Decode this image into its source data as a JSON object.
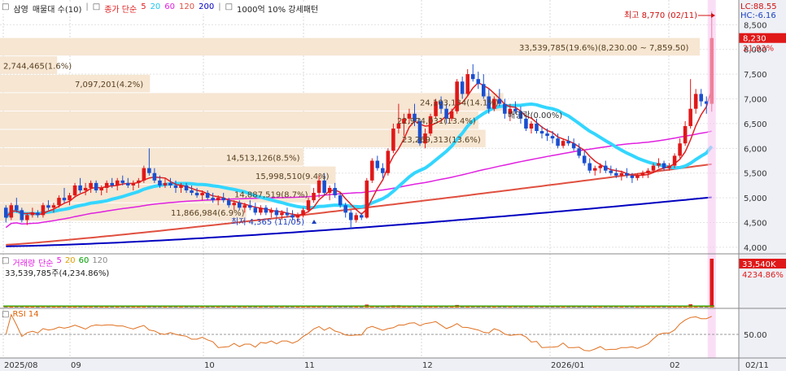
{
  "legend_main": {
    "checkbox": "□",
    "stock": "삼영",
    "pattern": "매물대 수(10)",
    "ma_label": "종가 단순",
    "ma_periods": [
      "5",
      "20",
      "60",
      "120",
      "200"
    ],
    "ma_colors": [
      "#e02020",
      "#33d6ff",
      "#e020e0",
      "#e05040",
      "#0000c0"
    ],
    "extra": "1000억 10% 강세패턴"
  },
  "legend_volume": {
    "title": "거래량",
    "ma_label": "단순",
    "periods": [
      "5",
      "20",
      "60",
      "120"
    ],
    "colors": [
      "#e020e0",
      "#e0a000",
      "#00a000",
      "#888888"
    ],
    "value_text": "33,539,785주(4,234.86%)"
  },
  "legend_rsi": {
    "title": "RSI 14"
  },
  "right_axis": {
    "top_lc": "LC:88.55",
    "top_hc": "HC:-6.16",
    "price_ticks": [
      "8,500",
      "8,000",
      "7,500",
      "7,000",
      "6,500",
      "6,000",
      "5,500",
      "5,000",
      "4,500",
      "4,000"
    ],
    "price_tag": "8,230",
    "price_tag_pct": "21.93%",
    "volume_tag": "33,540K",
    "volume_tag_pct": "4234.86%",
    "rsi_tick": "50.00"
  },
  "x_axis": {
    "labels": [
      "2025/08",
      "09",
      "10",
      "11",
      "12",
      "2026/01",
      "02"
    ],
    "current_date": "02/11"
  },
  "annotations": {
    "high": "최고 8,770 (02/11)",
    "low": "최저 4,365 (11/05)",
    "dividend": "배당락(0.00%)"
  },
  "chart_data": [
    {
      "type": "candlestick",
      "name": "price",
      "y_unit": "KRW",
      "ylim": [
        3900,
        8900
      ],
      "current_price": 8230,
      "change_pct": 21.93,
      "high": {
        "value": 8770,
        "date": "02/11"
      },
      "low": {
        "value": 4365,
        "date": "11/05"
      },
      "volume_profile_labels": [
        {
          "text": "33,539,785(19.6%)(8,230.00 ~ 7,859.50)",
          "price_lo": 7859.5,
          "price_hi": 8230,
          "pct": 19.6
        },
        {
          "text": "2,744,465(1.6%)",
          "price_lo": 7488,
          "price_hi": 7859.5,
          "pct": 1.6
        },
        {
          "text": "7,097,201(4.2%)",
          "price_lo": 7117,
          "price_hi": 7488,
          "pct": 4.2
        },
        {
          "text": "24,103,134(14.1%)",
          "price_lo": 6746,
          "price_hi": 7117,
          "pct": 14.1
        },
        {
          "text": "22,974,031(13.4%)",
          "price_lo": 6375,
          "price_hi": 6746,
          "pct": 13.4
        },
        {
          "text": "23,269,313(13.6%)",
          "price_lo": 6004,
          "price_hi": 6375,
          "pct": 13.6
        },
        {
          "text": "14,513,126(8.5%)",
          "price_lo": 5633,
          "price_hi": 6004,
          "pct": 8.5
        },
        {
          "text": "15,998,510(9.4%)",
          "price_lo": 5262,
          "price_hi": 5633,
          "pct": 9.4
        },
        {
          "text": "14,887,519(8.7%)",
          "price_lo": 4891,
          "price_hi": 5262,
          "pct": 8.7
        },
        {
          "text": "11,866,984(6.9%)",
          "price_lo": 4520,
          "price_hi": 4891,
          "pct": 6.9
        }
      ],
      "candles": [
        [
          4800,
          4850,
          4500,
          4600
        ],
        [
          4600,
          4900,
          4550,
          4850
        ],
        [
          4850,
          5000,
          4700,
          4750
        ],
        [
          4750,
          4800,
          4500,
          4550
        ],
        [
          4550,
          4700,
          4450,
          4650
        ],
        [
          4650,
          4800,
          4600,
          4700
        ],
        [
          4700,
          4750,
          4600,
          4650
        ],
        [
          4650,
          4900,
          4600,
          4850
        ],
        [
          4850,
          4950,
          4750,
          4800
        ],
        [
          4800,
          4900,
          4700,
          4850
        ],
        [
          4850,
          5050,
          4800,
          5000
        ],
        [
          5000,
          5200,
          4900,
          4950
        ],
        [
          4950,
          5100,
          4850,
          5050
        ],
        [
          5050,
          5300,
          5000,
          5250
        ],
        [
          5250,
          5400,
          5100,
          5150
        ],
        [
          5150,
          5300,
          5050,
          5200
        ],
        [
          5200,
          5350,
          5100,
          5300
        ],
        [
          5300,
          5350,
          5100,
          5150
        ],
        [
          5150,
          5250,
          5050,
          5200
        ],
        [
          5200,
          5350,
          5100,
          5300
        ],
        [
          5300,
          5400,
          5200,
          5250
        ],
        [
          5250,
          5400,
          5150,
          5350
        ],
        [
          5350,
          5450,
          5250,
          5300
        ],
        [
          5300,
          5400,
          5200,
          5250
        ],
        [
          5250,
          5350,
          5150,
          5300
        ],
        [
          5300,
          5400,
          5200,
          5350
        ],
        [
          5350,
          5650,
          5300,
          5600
        ],
        [
          5600,
          6000,
          5450,
          5500
        ],
        [
          5500,
          5600,
          5300,
          5350
        ],
        [
          5350,
          5450,
          5200,
          5250
        ],
        [
          5250,
          5400,
          5200,
          5300
        ],
        [
          5300,
          5400,
          5200,
          5250
        ],
        [
          5250,
          5350,
          5100,
          5200
        ],
        [
          5200,
          5300,
          5100,
          5250
        ],
        [
          5250,
          5300,
          5100,
          5150
        ],
        [
          5150,
          5250,
          5050,
          5100
        ],
        [
          5100,
          5200,
          5000,
          5050
        ],
        [
          5050,
          5150,
          4950,
          5100
        ],
        [
          5100,
          5150,
          4950,
          5000
        ],
        [
          5000,
          5100,
          4900,
          4950
        ],
        [
          4950,
          5050,
          4850,
          5000
        ],
        [
          5000,
          5100,
          4900,
          4950
        ],
        [
          4950,
          5000,
          4800,
          4850
        ],
        [
          4850,
          4950,
          4750,
          4900
        ],
        [
          4900,
          4950,
          4750,
          4800
        ],
        [
          4800,
          4900,
          4700,
          4850
        ],
        [
          4850,
          4950,
          4750,
          4800
        ],
        [
          4800,
          4900,
          4650,
          4700
        ],
        [
          4700,
          4850,
          4650,
          4800
        ],
        [
          4800,
          4850,
          4650,
          4700
        ],
        [
          4700,
          4800,
          4600,
          4750
        ],
        [
          4750,
          4800,
          4600,
          4650
        ],
        [
          4650,
          4750,
          4550,
          4700
        ],
        [
          4700,
          4800,
          4600,
          4650
        ],
        [
          4650,
          4750,
          4550,
          4600
        ],
        [
          4600,
          4700,
          4500,
          4650
        ],
        [
          4650,
          4800,
          4600,
          4750
        ],
        [
          4750,
          5000,
          4700,
          4950
        ],
        [
          4950,
          5200,
          4900,
          5100
        ],
        [
          5100,
          5450,
          5000,
          5350
        ],
        [
          5350,
          5500,
          5050,
          5100
        ],
        [
          5100,
          5250,
          4950,
          5200
        ],
        [
          5200,
          5300,
          5000,
          5050
        ],
        [
          5050,
          5100,
          4800,
          4850
        ],
        [
          4850,
          4900,
          4600,
          4700
        ],
        [
          4700,
          4750,
          4365,
          4550
        ],
        [
          4550,
          4700,
          4500,
          4650
        ],
        [
          4650,
          4700,
          4550,
          4600
        ],
        [
          4600,
          5400,
          4580,
          5350
        ],
        [
          5350,
          5800,
          5300,
          5750
        ],
        [
          5750,
          5850,
          5550,
          5600
        ],
        [
          5600,
          5700,
          5400,
          5500
        ],
        [
          5500,
          6000,
          5450,
          5950
        ],
        [
          5950,
          6500,
          5900,
          6400
        ],
        [
          6400,
          6900,
          6300,
          6500
        ],
        [
          6500,
          6700,
          6250,
          6600
        ],
        [
          6600,
          6800,
          6500,
          6700
        ],
        [
          6700,
          6900,
          6450,
          6550
        ],
        [
          6550,
          6600,
          6050,
          6100
        ],
        [
          6100,
          6400,
          6000,
          6300
        ],
        [
          6300,
          6700,
          6250,
          6650
        ],
        [
          6650,
          7000,
          6600,
          6950
        ],
        [
          6950,
          7050,
          6700,
          6800
        ],
        [
          6800,
          6900,
          6500,
          6600
        ],
        [
          6600,
          6800,
          6550,
          6750
        ],
        [
          6750,
          7400,
          6700,
          7350
        ],
        [
          7350,
          7450,
          7000,
          7100
        ],
        [
          7100,
          7600,
          7050,
          7500
        ],
        [
          7500,
          7700,
          7350,
          7400
        ],
        [
          7400,
          7550,
          7200,
          7300
        ],
        [
          7300,
          7500,
          7000,
          7050
        ],
        [
          7050,
          7200,
          6700,
          6800
        ],
        [
          6800,
          7050,
          6750,
          7000
        ],
        [
          7000,
          7200,
          6850,
          6900
        ],
        [
          6900,
          7000,
          6600,
          6700
        ],
        [
          6700,
          6900,
          6550,
          6800
        ],
        [
          6800,
          6950,
          6700,
          6750
        ],
        [
          6750,
          6850,
          6500,
          6600
        ],
        [
          6600,
          6650,
          6350,
          6400
        ],
        [
          6400,
          6550,
          6300,
          6500
        ],
        [
          6500,
          6600,
          6300,
          6350
        ],
        [
          6350,
          6450,
          6200,
          6300
        ],
        [
          6300,
          6400,
          6150,
          6250
        ],
        [
          6250,
          6350,
          6100,
          6200
        ],
        [
          6200,
          6300,
          6000,
          6050
        ],
        [
          6050,
          6200,
          6000,
          6150
        ],
        [
          6150,
          6250,
          6050,
          6100
        ],
        [
          6100,
          6200,
          5950,
          6000
        ],
        [
          6000,
          6100,
          5800,
          5850
        ],
        [
          5850,
          5950,
          5650,
          5700
        ],
        [
          5700,
          5800,
          5500,
          5550
        ],
        [
          5550,
          5650,
          5450,
          5600
        ],
        [
          5600,
          5700,
          5500,
          5650
        ],
        [
          5650,
          5750,
          5500,
          5550
        ],
        [
          5550,
          5650,
          5450,
          5500
        ],
        [
          5500,
          5600,
          5400,
          5450
        ],
        [
          5450,
          5550,
          5350,
          5500
        ],
        [
          5500,
          5600,
          5400,
          5450
        ],
        [
          5450,
          5500,
          5300,
          5400
        ],
        [
          5400,
          5500,
          5350,
          5450
        ],
        [
          5450,
          5550,
          5400,
          5500
        ],
        [
          5500,
          5600,
          5400,
          5550
        ],
        [
          5550,
          5700,
          5500,
          5650
        ],
        [
          5650,
          5800,
          5600,
          5700
        ],
        [
          5700,
          5750,
          5550,
          5600
        ],
        [
          5600,
          5700,
          5550,
          5650
        ],
        [
          5650,
          5900,
          5600,
          5850
        ],
        [
          5850,
          6200,
          5800,
          6100
        ],
        [
          6100,
          6550,
          6050,
          6450
        ],
        [
          6450,
          7400,
          6400,
          6800
        ],
        [
          6800,
          7200,
          6700,
          7100
        ],
        [
          7100,
          7200,
          6850,
          6950
        ],
        [
          6950,
          7050,
          6700,
          6900
        ],
        [
          6900,
          8770,
          6740,
          8230
        ]
      ]
    },
    {
      "type": "line",
      "name": "RSI 14",
      "reference_line": 50.0
    }
  ]
}
